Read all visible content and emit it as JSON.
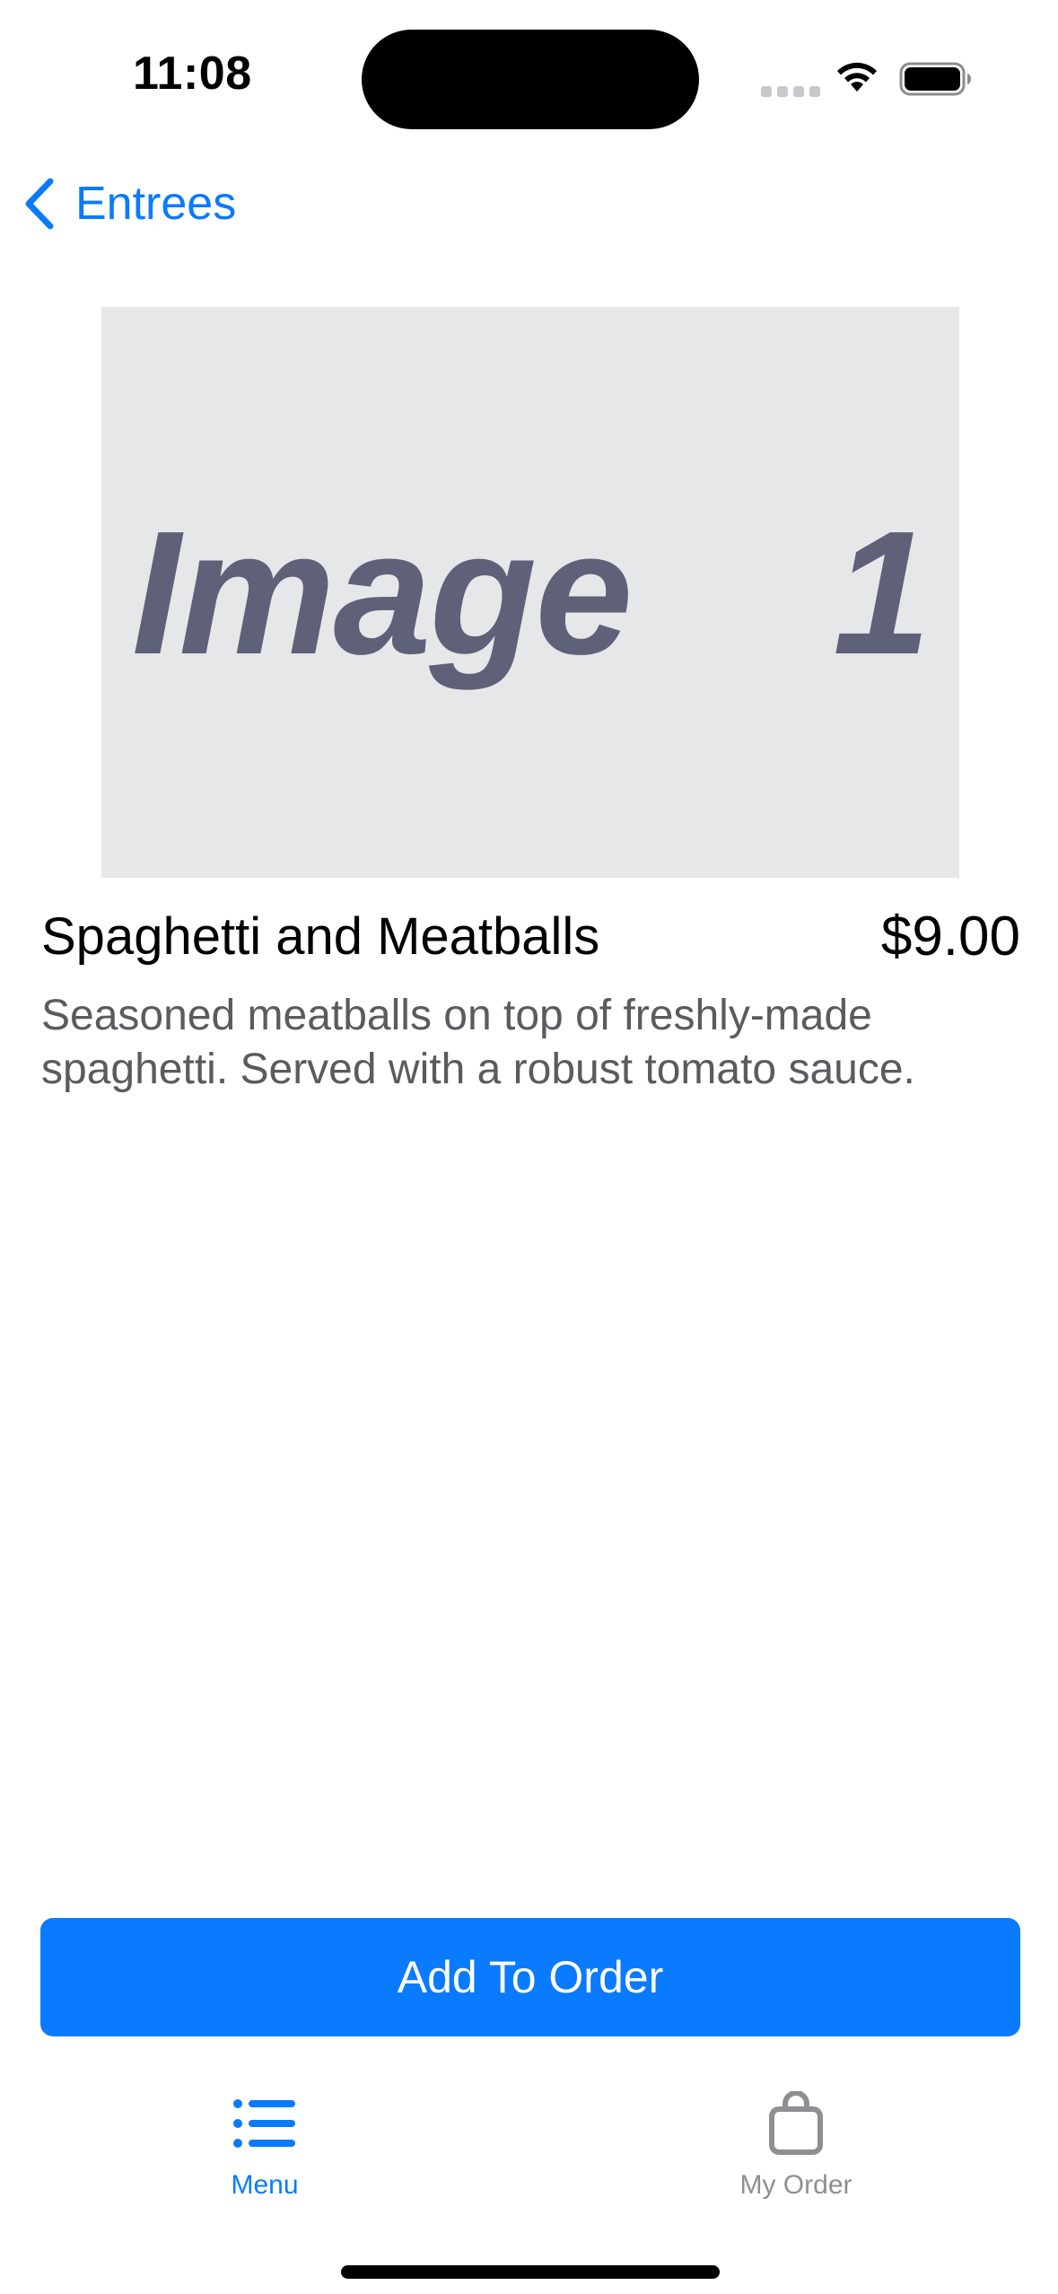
{
  "status_bar": {
    "time": "11:08"
  },
  "nav": {
    "back_label": "Entrees",
    "back_icon": "chevron-left-icon"
  },
  "item": {
    "image_placeholder_text": "Image  1",
    "name": "Spaghetti and Meatballs",
    "price": "$9.00",
    "description": "Seasoned meatballs on top of freshly-made spaghetti. Served with a robust tomato sauce."
  },
  "actions": {
    "add_to_order_label": "Add To Order"
  },
  "tab_bar": {
    "tabs": [
      {
        "label": "Menu",
        "icon": "list-icon",
        "selected": true
      },
      {
        "label": "My Order",
        "icon": "bag-icon",
        "selected": false
      }
    ]
  },
  "colors": {
    "accent": "#0a7aff",
    "placeholder_bg": "#e6e7e9",
    "placeholder_text": "#5e6178",
    "secondary_text": "#5b5b5f",
    "inactive_tab": "#8e8e93"
  }
}
